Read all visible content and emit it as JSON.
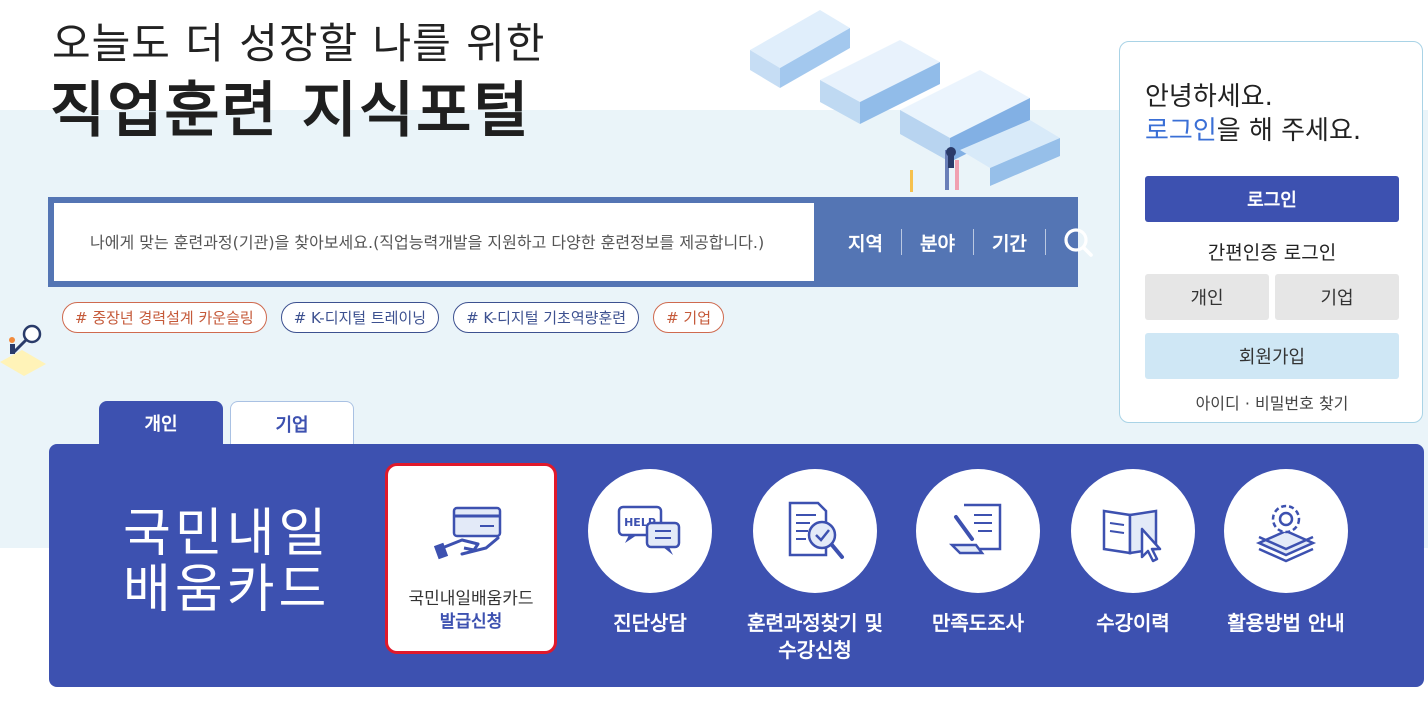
{
  "hero": {
    "subtitle": "오늘도 더 성장할 나를 위한",
    "title": "직업훈련 지식포털"
  },
  "search": {
    "placeholder": "나에게 맞는 훈련과정(기관)을 찾아보세요.(직업능력개발을 지원하고 다양한 훈련정보를 제공합니다.)",
    "filters": [
      "지역",
      "분야",
      "기간"
    ],
    "search_icon": "search-icon"
  },
  "tags": [
    "# 중장년 경력설계 카운슬링",
    "# K-디지털 트레이닝",
    "# K-디지털 기초역량훈련",
    "# 기업"
  ],
  "login": {
    "greeting": "안녕하세요.",
    "prompt_link": "로그인",
    "prompt_rest": "을 해 주세요.",
    "login_button": "로그인",
    "easy_login": "간편인증 로그인",
    "personal": "개인",
    "corporate": "기업",
    "join": "회원가입",
    "find": "아이디 · 비밀번호 찾기"
  },
  "tabs": [
    "개인",
    "기업"
  ],
  "panel": {
    "title_line1": "국민내일",
    "title_line2": "배움카드",
    "selected_card": {
      "line1": "국민내일배움카드",
      "line2": "발급신청",
      "icon": "card-hand-icon"
    },
    "items": [
      {
        "label": "진단상담",
        "icon": "help-chat-icon"
      },
      {
        "label_line1": "훈련과정찾기 및",
        "label_line2": "수강신청",
        "icon": "document-search-icon"
      },
      {
        "label": "만족도조사",
        "icon": "survey-scroll-icon"
      },
      {
        "label": "수강이력",
        "icon": "book-cursor-icon"
      },
      {
        "label": "활용방법 안내",
        "icon": "gear-stack-icon"
      }
    ]
  },
  "colors": {
    "primary": "#3d51b0",
    "search_bar": "#5475b4",
    "link": "#3a6fd6",
    "highlight_border": "#e0192b",
    "background_band": "#eaf4f9"
  }
}
